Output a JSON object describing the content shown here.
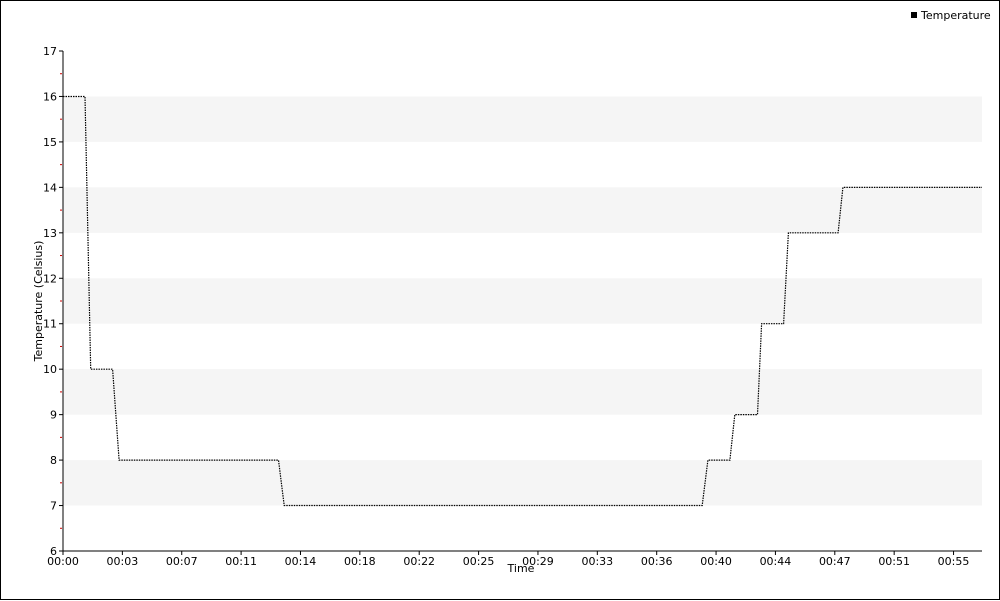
{
  "chart_data": {
    "type": "line",
    "xlabel": "Time",
    "ylabel": "Temperature (Celsius)",
    "ylim": [
      6,
      17
    ],
    "yticks": [
      "6",
      "7",
      "8",
      "9",
      "10",
      "11",
      "12",
      "13",
      "14",
      "15",
      "16",
      "17"
    ],
    "xlim_minutes": [
      0,
      56.5
    ],
    "xticks": [
      {
        "label": "00:00",
        "minute": 0
      },
      {
        "label": "00:03",
        "minute": 3.65
      },
      {
        "label": "00:07",
        "minute": 7.3
      },
      {
        "label": "00:11",
        "minute": 10.95
      },
      {
        "label": "00:14",
        "minute": 14.6
      },
      {
        "label": "00:18",
        "minute": 18.25
      },
      {
        "label": "00:22",
        "minute": 21.9
      },
      {
        "label": "00:25",
        "minute": 25.55
      },
      {
        "label": "00:29",
        "minute": 29.2
      },
      {
        "label": "00:33",
        "minute": 32.85
      },
      {
        "label": "00:36",
        "minute": 36.5
      },
      {
        "label": "00:40",
        "minute": 40.15
      },
      {
        "label": "00:44",
        "minute": 43.8
      },
      {
        "label": "00:47",
        "minute": 47.45
      },
      {
        "label": "00:51",
        "minute": 51.1
      },
      {
        "label": "00:55",
        "minute": 54.75
      }
    ],
    "legend": {
      "position": "top-right",
      "entries": [
        "Temperature"
      ]
    },
    "grid": "alternating horizontal bands",
    "colors": {
      "line": "#000000",
      "band": "#f5f5f5",
      "minor_tick": "#cc0000"
    },
    "series": [
      {
        "name": "Temperature",
        "points": [
          {
            "x": 0,
            "y": 16
          },
          {
            "x": 1.35,
            "y": 16
          },
          {
            "x": 1.7,
            "y": 10
          },
          {
            "x": 3.05,
            "y": 10
          },
          {
            "x": 3.45,
            "y": 8
          },
          {
            "x": 13.25,
            "y": 8
          },
          {
            "x": 13.6,
            "y": 7
          },
          {
            "x": 39.3,
            "y": 7
          },
          {
            "x": 39.65,
            "y": 8
          },
          {
            "x": 41.0,
            "y": 8
          },
          {
            "x": 41.3,
            "y": 9
          },
          {
            "x": 42.7,
            "y": 9
          },
          {
            "x": 42.95,
            "y": 11
          },
          {
            "x": 44.3,
            "y": 11
          },
          {
            "x": 44.6,
            "y": 13
          },
          {
            "x": 47.65,
            "y": 13
          },
          {
            "x": 47.95,
            "y": 14
          },
          {
            "x": 56.5,
            "y": 14
          }
        ]
      }
    ]
  }
}
